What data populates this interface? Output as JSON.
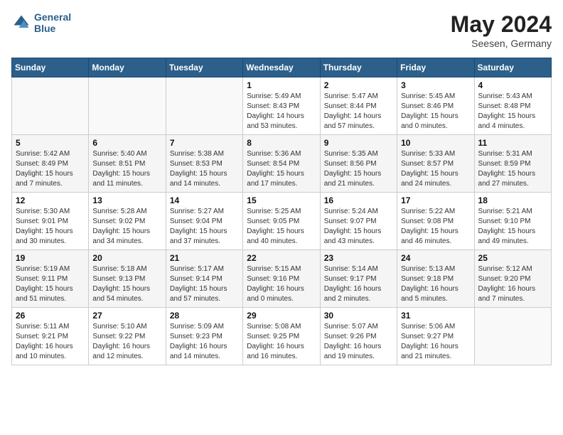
{
  "header": {
    "logo_line1": "General",
    "logo_line2": "Blue",
    "month_year": "May 2024",
    "location": "Seesen, Germany"
  },
  "weekdays": [
    "Sunday",
    "Monday",
    "Tuesday",
    "Wednesday",
    "Thursday",
    "Friday",
    "Saturday"
  ],
  "weeks": [
    [
      {
        "day": "",
        "info": ""
      },
      {
        "day": "",
        "info": ""
      },
      {
        "day": "",
        "info": ""
      },
      {
        "day": "1",
        "info": "Sunrise: 5:49 AM\nSunset: 8:43 PM\nDaylight: 14 hours\nand 53 minutes."
      },
      {
        "day": "2",
        "info": "Sunrise: 5:47 AM\nSunset: 8:44 PM\nDaylight: 14 hours\nand 57 minutes."
      },
      {
        "day": "3",
        "info": "Sunrise: 5:45 AM\nSunset: 8:46 PM\nDaylight: 15 hours\nand 0 minutes."
      },
      {
        "day": "4",
        "info": "Sunrise: 5:43 AM\nSunset: 8:48 PM\nDaylight: 15 hours\nand 4 minutes."
      }
    ],
    [
      {
        "day": "5",
        "info": "Sunrise: 5:42 AM\nSunset: 8:49 PM\nDaylight: 15 hours\nand 7 minutes."
      },
      {
        "day": "6",
        "info": "Sunrise: 5:40 AM\nSunset: 8:51 PM\nDaylight: 15 hours\nand 11 minutes."
      },
      {
        "day": "7",
        "info": "Sunrise: 5:38 AM\nSunset: 8:53 PM\nDaylight: 15 hours\nand 14 minutes."
      },
      {
        "day": "8",
        "info": "Sunrise: 5:36 AM\nSunset: 8:54 PM\nDaylight: 15 hours\nand 17 minutes."
      },
      {
        "day": "9",
        "info": "Sunrise: 5:35 AM\nSunset: 8:56 PM\nDaylight: 15 hours\nand 21 minutes."
      },
      {
        "day": "10",
        "info": "Sunrise: 5:33 AM\nSunset: 8:57 PM\nDaylight: 15 hours\nand 24 minutes."
      },
      {
        "day": "11",
        "info": "Sunrise: 5:31 AM\nSunset: 8:59 PM\nDaylight: 15 hours\nand 27 minutes."
      }
    ],
    [
      {
        "day": "12",
        "info": "Sunrise: 5:30 AM\nSunset: 9:01 PM\nDaylight: 15 hours\nand 30 minutes."
      },
      {
        "day": "13",
        "info": "Sunrise: 5:28 AM\nSunset: 9:02 PM\nDaylight: 15 hours\nand 34 minutes."
      },
      {
        "day": "14",
        "info": "Sunrise: 5:27 AM\nSunset: 9:04 PM\nDaylight: 15 hours\nand 37 minutes."
      },
      {
        "day": "15",
        "info": "Sunrise: 5:25 AM\nSunset: 9:05 PM\nDaylight: 15 hours\nand 40 minutes."
      },
      {
        "day": "16",
        "info": "Sunrise: 5:24 AM\nSunset: 9:07 PM\nDaylight: 15 hours\nand 43 minutes."
      },
      {
        "day": "17",
        "info": "Sunrise: 5:22 AM\nSunset: 9:08 PM\nDaylight: 15 hours\nand 46 minutes."
      },
      {
        "day": "18",
        "info": "Sunrise: 5:21 AM\nSunset: 9:10 PM\nDaylight: 15 hours\nand 49 minutes."
      }
    ],
    [
      {
        "day": "19",
        "info": "Sunrise: 5:19 AM\nSunset: 9:11 PM\nDaylight: 15 hours\nand 51 minutes."
      },
      {
        "day": "20",
        "info": "Sunrise: 5:18 AM\nSunset: 9:13 PM\nDaylight: 15 hours\nand 54 minutes."
      },
      {
        "day": "21",
        "info": "Sunrise: 5:17 AM\nSunset: 9:14 PM\nDaylight: 15 hours\nand 57 minutes."
      },
      {
        "day": "22",
        "info": "Sunrise: 5:15 AM\nSunset: 9:16 PM\nDaylight: 16 hours\nand 0 minutes."
      },
      {
        "day": "23",
        "info": "Sunrise: 5:14 AM\nSunset: 9:17 PM\nDaylight: 16 hours\nand 2 minutes."
      },
      {
        "day": "24",
        "info": "Sunrise: 5:13 AM\nSunset: 9:18 PM\nDaylight: 16 hours\nand 5 minutes."
      },
      {
        "day": "25",
        "info": "Sunrise: 5:12 AM\nSunset: 9:20 PM\nDaylight: 16 hours\nand 7 minutes."
      }
    ],
    [
      {
        "day": "26",
        "info": "Sunrise: 5:11 AM\nSunset: 9:21 PM\nDaylight: 16 hours\nand 10 minutes."
      },
      {
        "day": "27",
        "info": "Sunrise: 5:10 AM\nSunset: 9:22 PM\nDaylight: 16 hours\nand 12 minutes."
      },
      {
        "day": "28",
        "info": "Sunrise: 5:09 AM\nSunset: 9:23 PM\nDaylight: 16 hours\nand 14 minutes."
      },
      {
        "day": "29",
        "info": "Sunrise: 5:08 AM\nSunset: 9:25 PM\nDaylight: 16 hours\nand 16 minutes."
      },
      {
        "day": "30",
        "info": "Sunrise: 5:07 AM\nSunset: 9:26 PM\nDaylight: 16 hours\nand 19 minutes."
      },
      {
        "day": "31",
        "info": "Sunrise: 5:06 AM\nSunset: 9:27 PM\nDaylight: 16 hours\nand 21 minutes."
      },
      {
        "day": "",
        "info": ""
      }
    ]
  ]
}
